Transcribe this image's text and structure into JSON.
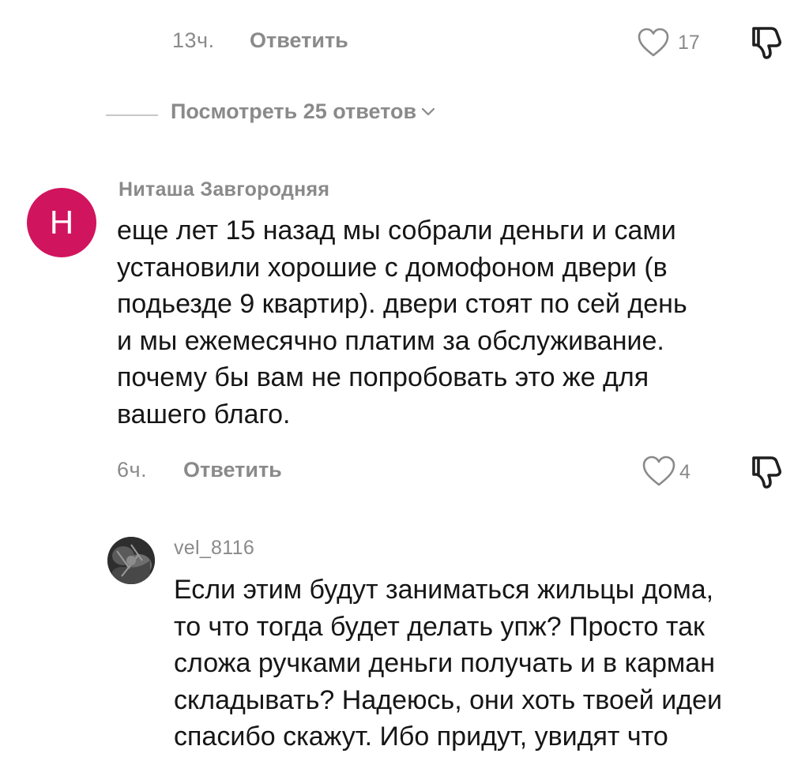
{
  "comment_top": {
    "time": "13ч.",
    "reply_label": "Ответить",
    "likes": "17"
  },
  "view_replies": {
    "label": "Посмотреть 25 ответов"
  },
  "comment_main": {
    "avatar_letter": "Н",
    "author": "Ниташа Завгородняя",
    "lines": [
      "еще лет 15 назад мы собрали деньги и сами",
      "установили хорошие с домофоном двери (в",
      "подьезде 9 квартир). двери стоят по сей день",
      "и мы ежемесячно платим за обслуживание.",
      "почему бы вам не попробовать это же для",
      "вашего благо."
    ],
    "time": "6ч.",
    "reply_label": "Ответить",
    "likes": "4"
  },
  "reply": {
    "author": "vel_8116",
    "lines": [
      "Если этим будут заниматься жильцы дома,",
      "то что тогда будет делать упж? Просто так",
      "сложа ручками деньги получать и в карман",
      "складывать? Надеюсь, они хоть твоей идеи",
      "спасибо скажут. Ибо придут, увидят что"
    ]
  },
  "colors": {
    "avatar_bg": "#d1145e",
    "muted_text": "#8a8a8a",
    "body_text": "#161616"
  },
  "icons": [
    "heart-outline-icon",
    "dislike-icon",
    "chevron-down-icon"
  ]
}
